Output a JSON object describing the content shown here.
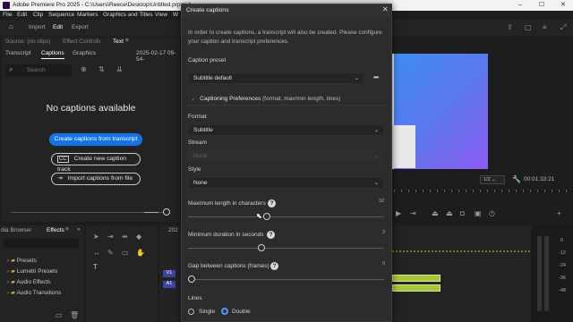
{
  "window": {
    "title": "Adobe Premiere Pro 2025 - C:\\Users\\Reece\\Desktop\\Untitled.prproj *",
    "minimize": "–",
    "maximize": "☐",
    "close": "✕"
  },
  "menubar": [
    "File",
    "Edit",
    "Clip",
    "Sequence",
    "Markers",
    "Graphics and Titles",
    "View",
    "W"
  ],
  "topnav": {
    "import": "Import",
    "edit": "Edit",
    "export": "Export"
  },
  "left_panel": {
    "source_tab": "Source: (no clips)",
    "effect_controls_tab": "Effect Controls",
    "text_tab": "Text",
    "subtabs": [
      "Transcript",
      "Captions",
      "Graphics"
    ],
    "date": "2025-02-17 09-54-",
    "search_placeholder": "Search",
    "no_captions": "No captions available",
    "create_from_transcript": "Create captions from transcript",
    "create_new_track": "Create new caption track",
    "import_from_file": "Import captions from file"
  },
  "effects_panel": {
    "tab_browser": "dia Browser",
    "tab_effects": "Effects",
    "items": [
      "Presets",
      "Lumetri Presets",
      "Audio Effects",
      "Audio Transitions"
    ]
  },
  "timeline": {
    "seq_label": "202",
    "track_v1": "V1",
    "track_a1": "A1"
  },
  "monitor": {
    "fit": "1/2",
    "timecode": "00:01:33:21"
  },
  "meter": {
    "ticks": [
      "0",
      "-12",
      "-24",
      "-36",
      "-48"
    ]
  },
  "dialog": {
    "title": "Create captions",
    "intro": "In order to create captions, a transcript will also be created. Please configure your caption and transcript preferences.",
    "caption_preset_label": "Caption preset",
    "caption_preset_value": "Subtitle default",
    "preferences_header": "Captioning Preferences",
    "preferences_sub": "(format, max/min length, lines)",
    "format_label": "Format",
    "format_value": "Subtitle",
    "stream_label": "Stream",
    "stream_value": "None",
    "style_label": "Style",
    "style_value": "None",
    "max_length_label": "Maximum length in characters",
    "max_length_value": "32",
    "max_length_fraction": 0.4,
    "min_duration_label": "Minimum duration in seconds",
    "min_duration_value": "3",
    "min_duration_fraction": 0.37,
    "gap_label": "Gap between captions (frames)",
    "gap_value": "0",
    "gap_fraction": 0.0,
    "lines_label": "Lines",
    "lines_single": "Single",
    "lines_double": "Double",
    "lines_selected": "Double"
  }
}
